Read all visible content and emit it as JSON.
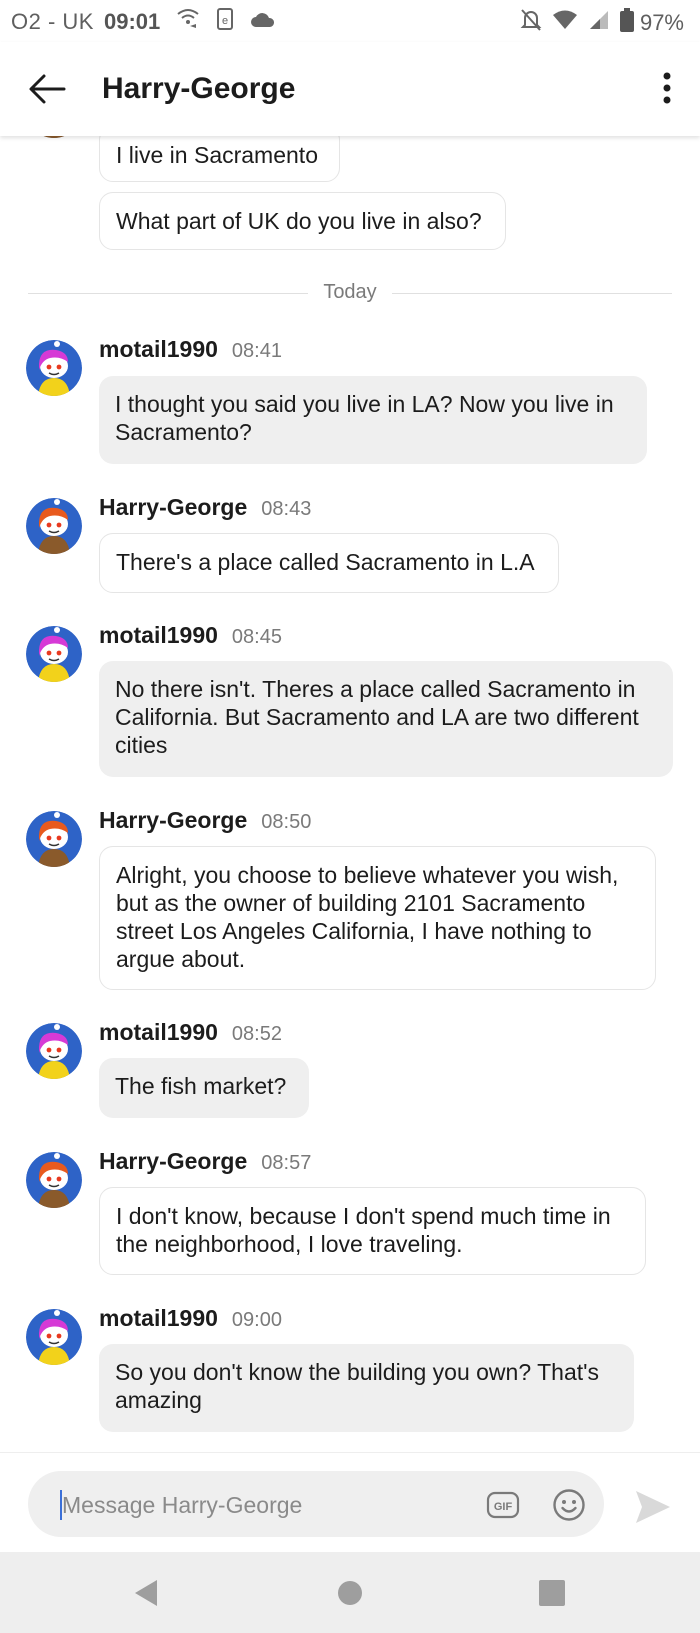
{
  "status_bar": {
    "carrier": "O2 - UK",
    "time": "09:01",
    "battery": "97%",
    "icons": [
      "wifi-call-icon",
      "sim-icon",
      "cloud-icon",
      "mute-icon",
      "wifi-icon",
      "signal-icon",
      "battery-icon"
    ]
  },
  "header": {
    "title": "Harry-George",
    "back_icon": "arrow-left-icon",
    "menu_icon": "more-vertical-icon"
  },
  "earlier_messages": [
    {
      "text": "I live in Sacramento"
    },
    {
      "text": "What part of UK do you live in also?"
    }
  ],
  "divider": {
    "label": "Today"
  },
  "messages": [
    {
      "author": "motail1990",
      "time": "08:41",
      "text": "I thought you said you live in LA? Now you live in Sacramento?"
    },
    {
      "author": "Harry-George",
      "time": "08:43",
      "text": "There's a place called Sacramento in L.A"
    },
    {
      "author": "motail1990",
      "time": "08:45",
      "text": "No there isn't. Theres a place called Sacramento in California. But Sacramento and LA are two different cities"
    },
    {
      "author": "Harry-George",
      "time": "08:50",
      "text": "Alright, you choose to believe whatever you wish, but as the owner of building 2101 Sacramento street Los Angeles California, I have nothing to argue about."
    },
    {
      "author": "motail1990",
      "time": "08:52",
      "text": "The fish market?"
    },
    {
      "author": "Harry-George",
      "time": "08:57",
      "text": "I don't know, because I don't spend much time in the neighborhood, I love traveling."
    },
    {
      "author": "motail1990",
      "time": "09:00",
      "text": "So you don't know the building you own? That's amazing"
    }
  ],
  "composer": {
    "placeholder": "Message Harry-George",
    "value": "",
    "gif_label": "GIF"
  },
  "colors": {
    "accent": "#3a6fd8",
    "avatar_bg": "#2e63c7",
    "motail_hair": "#d63ad6",
    "harry_hair": "#e85a1e",
    "filled_bubble": "#efefef"
  }
}
